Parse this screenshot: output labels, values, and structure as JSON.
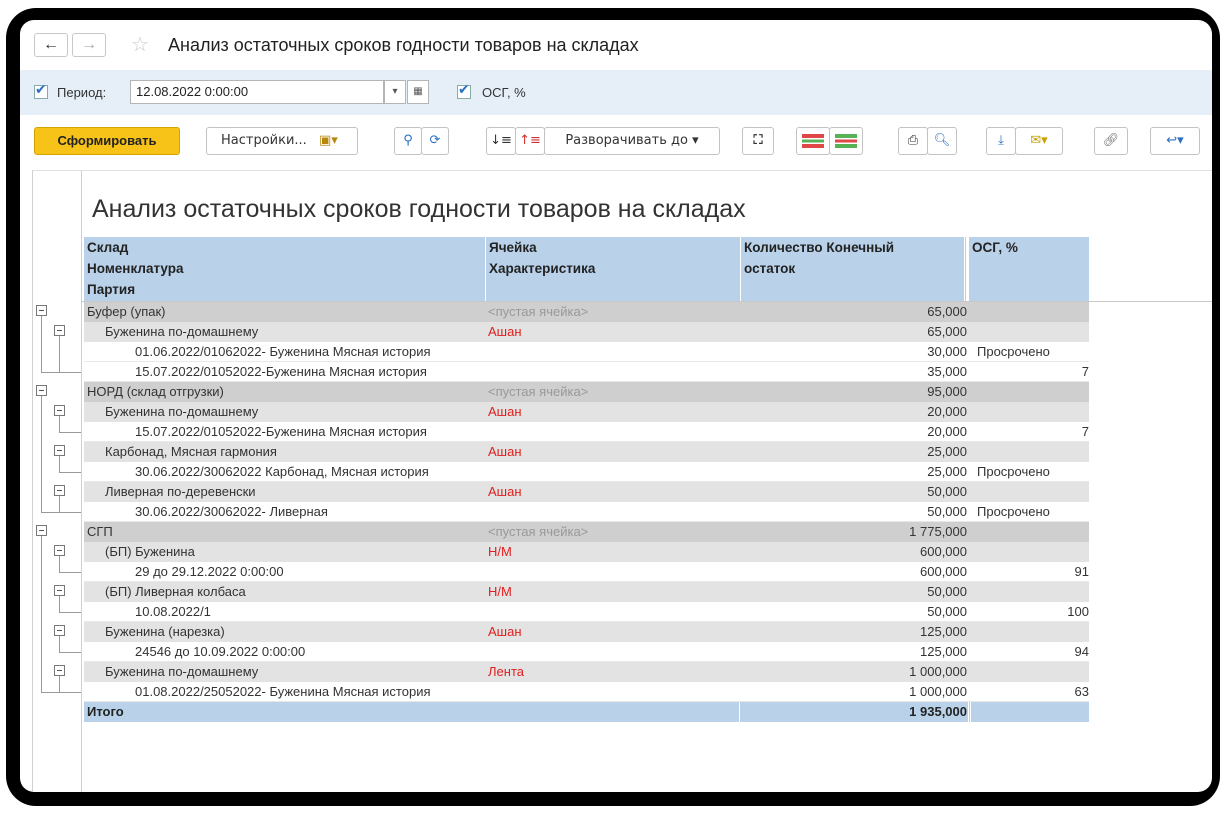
{
  "window": {
    "title": "Анализ остаточных сроков годности товаров на складах",
    "back_icon": "←",
    "forward_icon": "→",
    "favorite_icon": "☆"
  },
  "params": {
    "period_label": "Период:",
    "period_value": "12.08.2022  0:00:00",
    "osg_label": "ОСГ, %",
    "period_checked": true,
    "osg_checked": true
  },
  "toolbar": {
    "generate_label": "Сформировать",
    "settings_label": "Настройки...",
    "expand_label": "Разворачивать до"
  },
  "report": {
    "title": "Анализ остаточных сроков годности товаров на складах",
    "header": {
      "col1_l1": "Склад",
      "col1_l2": "Номенклатура",
      "col1_l3": "Партия",
      "col2_l1": "Ячейка",
      "col2_l2": "Характеристика",
      "col3_l1": "Количество Конечный",
      "col3_l2": "остаток",
      "col4_l1": "ОСГ, %"
    },
    "rows": [
      {
        "level": 0,
        "name": "Буфер (упак)",
        "cell": "<пустая ячейка>",
        "qty": "65,000",
        "osg": ""
      },
      {
        "level": 1,
        "name": "Буженина по-домашнему",
        "cell": "Ашан",
        "qty": "65,000",
        "osg": ""
      },
      {
        "level": 2,
        "name": "01.06.2022/01062022- Буженина Мясная история",
        "cell": "",
        "qty": "30,000",
        "osg": "Просрочено"
      },
      {
        "level": 2,
        "name": "15.07.2022/01052022-Буженина Мясная история",
        "cell": "",
        "qty": "35,000",
        "osg": "7"
      },
      {
        "level": 0,
        "name": "НОРД (склад отгрузки)",
        "cell": "<пустая ячейка>",
        "qty": "95,000",
        "osg": ""
      },
      {
        "level": 1,
        "name": "Буженина по-домашнему",
        "cell": "Ашан",
        "qty": "20,000",
        "osg": ""
      },
      {
        "level": 2,
        "name": "15.07.2022/01052022-Буженина Мясная история",
        "cell": "",
        "qty": "20,000",
        "osg": "7"
      },
      {
        "level": 1,
        "name": "Карбонад, Мясная гармония",
        "cell": "Ашан",
        "qty": "25,000",
        "osg": ""
      },
      {
        "level": 2,
        "name": "30.06.2022/30062022 Карбонад, Мясная история",
        "cell": "",
        "qty": "25,000",
        "osg": "Просрочено"
      },
      {
        "level": 1,
        "name": "Ливерная по-деревенски",
        "cell": "Ашан",
        "qty": "50,000",
        "osg": ""
      },
      {
        "level": 2,
        "name": "30.06.2022/30062022- Ливерная",
        "cell": "",
        "qty": "50,000",
        "osg": "Просрочено"
      },
      {
        "level": 0,
        "name": "СГП",
        "cell": "<пустая ячейка>",
        "qty": "1 775,000",
        "osg": ""
      },
      {
        "level": 1,
        "name": "(БП) Буженина",
        "cell": "Н/М",
        "qty": "600,000",
        "osg": ""
      },
      {
        "level": 2,
        "name": "29 до 29.12.2022 0:00:00",
        "cell": "",
        "qty": "600,000",
        "osg": "91"
      },
      {
        "level": 1,
        "name": "(БП) Ливерная колбаса",
        "cell": "Н/М",
        "qty": "50,000",
        "osg": ""
      },
      {
        "level": 2,
        "name": "10.08.2022/1",
        "cell": "",
        "qty": "50,000",
        "osg": "100"
      },
      {
        "level": 1,
        "name": "Буженина (нарезка)",
        "cell": "Ашан",
        "qty": "125,000",
        "osg": ""
      },
      {
        "level": 2,
        "name": "24546 до 10.09.2022 0:00:00",
        "cell": "",
        "qty": "125,000",
        "osg": "94"
      },
      {
        "level": 1,
        "name": "Буженина по-домашнему",
        "cell": "Лента",
        "qty": "1 000,000",
        "osg": ""
      },
      {
        "level": 2,
        "name": "01.08.2022/25052022- Буженина Мясная история",
        "cell": "",
        "qty": "1 000,000",
        "osg": "63"
      }
    ],
    "total": {
      "label": "Итого",
      "qty": "1 935,000"
    }
  }
}
